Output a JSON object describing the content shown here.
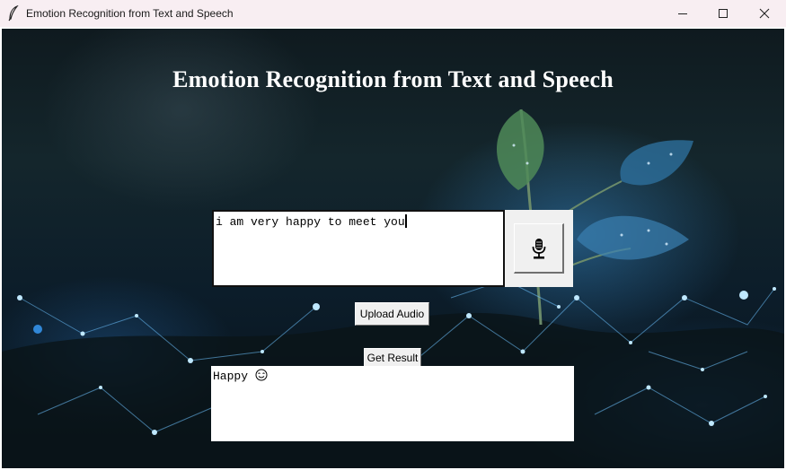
{
  "window": {
    "title": "Emotion Recognition from Text and Speech",
    "app_icon": "feather-icon",
    "controls": [
      "minimize-icon",
      "maximize-icon",
      "close-icon"
    ]
  },
  "main": {
    "heading": "Emotion Recognition from Text and Speech",
    "text_input_value": "i am very happy to meet you",
    "mic_icon": "microphone-icon",
    "upload_label": "Upload Audio",
    "result_label": "Get Result",
    "result_text": "Happy",
    "result_emoji_icon": "smiling-face-icon"
  },
  "colors": {
    "titlebar_bg": "#f8eef2",
    "button_bg": "#f0f0f0",
    "heading_text": "#ffffff"
  }
}
